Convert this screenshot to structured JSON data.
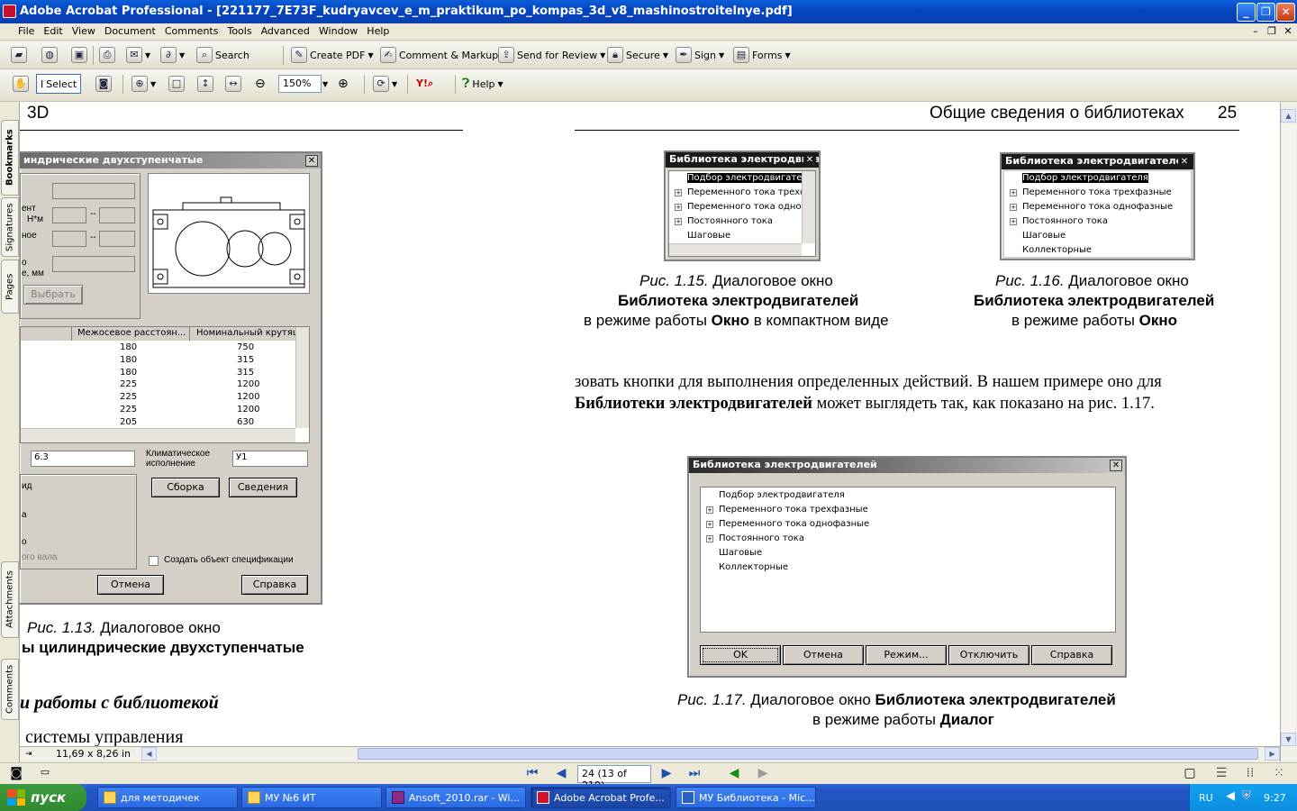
{
  "window": {
    "title": "Adobe Acrobat Professional - [221177_7E73F_kudryavcev_e_m_praktikum_po_kompas_3d_v8_mashinostroitelnye.pdf]"
  },
  "menu": [
    "File",
    "Edit",
    "View",
    "Document",
    "Comments",
    "Tools",
    "Advanced",
    "Window",
    "Help"
  ],
  "toolbar1": {
    "search": "Search",
    "create_pdf": "Create PDF",
    "comment_markup": "Comment & Markup",
    "send_review": "Send for Review",
    "secure": "Secure",
    "sign": "Sign",
    "forms": "Forms"
  },
  "toolbar2": {
    "select": "Select",
    "zoom": "150%",
    "help": "Help"
  },
  "left_tabs": [
    "Bookmarks",
    "Signatures",
    "Pages",
    "Attachments",
    "Comments"
  ],
  "page": {
    "header_left": "3D",
    "header_right": "Общие сведения о библиотеках",
    "page_number": "25",
    "body_line1": "зовать кнопки для выполнения определенных действий. В нашем примере оно для",
    "body_line2_bold": "Библиотеки электродвигателей",
    "body_line2_rest": " может выглядеть так, как показано на рис. 1.17.",
    "left_heading": "и работы с библиотекой",
    "left_body": "системы   управления"
  },
  "fig13": {
    "dialog_title": "индрические двухступенчатые",
    "labels": [
      "ент",
      "Н*м",
      "ное",
      "о",
      "е, мм"
    ],
    "select_button": "Выбрать",
    "columns": [
      "Межосевое расстоян...",
      "Номинальный крутящ"
    ],
    "rows": [
      [
        "180",
        "750"
      ],
      [
        "180",
        "315"
      ],
      [
        "180",
        "315"
      ],
      [
        "225",
        "1200"
      ],
      [
        "225",
        "1200"
      ],
      [
        "225",
        "1200"
      ],
      [
        "205",
        "630"
      ]
    ],
    "ratio_value": "6.3",
    "climate_label": "Климатическое исполнение",
    "climate_value": "У1",
    "assembly_button": "Сборка",
    "info_button": "Сведения",
    "partial_labels": [
      "ид",
      "а",
      "о",
      "ого вала"
    ],
    "spec_checkbox": "Создать объект спецификации",
    "cancel_button": "Отмена",
    "help_button": "Справка",
    "caption_italic": "Рис. 1.13.",
    "caption_rest": " Диалоговое окно",
    "caption_line2": "ы цилиндрические двухступенчатые"
  },
  "fig15": {
    "title": "Библиотека электродвига",
    "items": [
      "Подбор электродвигател",
      "Переменного тока трехф",
      "Переменного тока одноф",
      "Постоянного тока",
      "Шаговые"
    ],
    "caption_italic": "Рис. 1.15.",
    "caption_rest": " Диалоговое окно",
    "caption_bold": "Библиотека электродвигателей",
    "caption_line3_a": "в режиме работы ",
    "caption_line3_b": "Окно",
    "caption_line3_c": " в компактном виде"
  },
  "fig16": {
    "title": "Библиотека электродвигателей",
    "items": [
      "Подбор электродвигателя",
      "Переменного тока трехфазные",
      "Переменного тока однофазные",
      "Постоянного тока",
      "Шаговые",
      "Коллекторные"
    ],
    "caption_italic": "Рис. 1.16.",
    "caption_rest": " Диалоговое окно",
    "caption_bold": "Библиотека электродвигателей",
    "caption_line3_a": "в режиме работы ",
    "caption_line3_b": "Окно"
  },
  "fig17": {
    "title": "Библиотека электродвигателей",
    "items": [
      "Подбор электродвигателя",
      "Переменного тока трехфазные",
      "Переменного тока однофазные",
      "Постоянного тока",
      "Шаговые",
      "Коллекторные"
    ],
    "buttons": [
      "OK",
      "Отмена",
      "Режим...",
      "Отключить",
      "Справка"
    ],
    "caption_italic": "Рис. 1.17.",
    "caption_rest": " Диалоговое окно ",
    "caption_bold": "Библиотека электродвигателей",
    "caption_line2_a": "в режиме работы ",
    "caption_line2_b": "Диалог"
  },
  "statusbar": {
    "page_size": "11,69 x 8,26 in"
  },
  "nav": {
    "page_field": "24 (13 of 219)"
  },
  "taskbar": {
    "start": "пуск",
    "tasks": [
      "для методичек",
      "МУ №6 ИТ",
      "Ansoft_2010.rar - Wi...",
      "Adobe Acrobat Profe...",
      "МУ Библиотека - Mic..."
    ],
    "lang": "RU",
    "clock": "9:27"
  }
}
